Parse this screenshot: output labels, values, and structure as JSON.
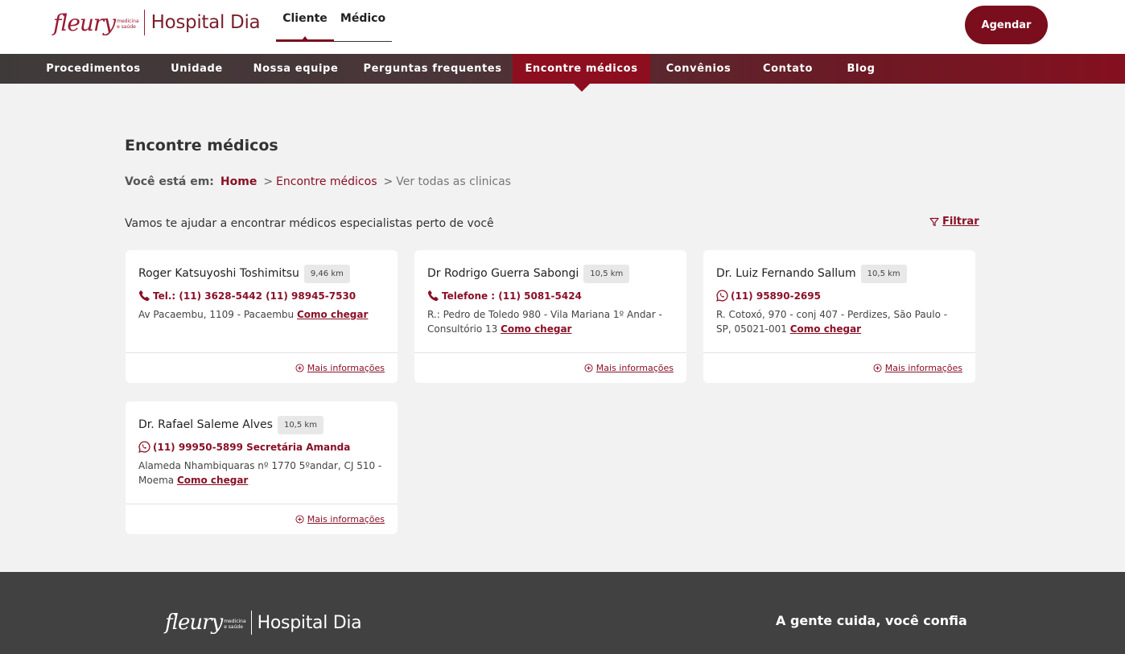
{
  "header": {
    "logo_brand": "fleury",
    "logo_tagline_1": "medicina",
    "logo_tagline_2": "e saúde",
    "logo_product": "Hospital Dia",
    "tabs": [
      {
        "label": "Cliente",
        "active": true
      },
      {
        "label": "Médico",
        "active": false
      }
    ],
    "cta_label": "Agendar"
  },
  "nav": {
    "items": [
      {
        "label": "Procedimentos"
      },
      {
        "label": "Unidade"
      },
      {
        "label": "Nossa equipe"
      },
      {
        "label": "Perguntas frequentes"
      },
      {
        "label": "Encontre médicos",
        "active": true
      },
      {
        "label": "Convênios"
      },
      {
        "label": "Contato"
      },
      {
        "label": "Blog"
      }
    ]
  },
  "main": {
    "title": "Encontre médicos",
    "breadcrumb": {
      "label": "Você está em:",
      "home": "Home",
      "sep": ">",
      "link": "Encontre médicos",
      "current": "Ver todas as clinicas"
    },
    "intro": "Vamos te ajudar a encontrar médicos especialistas perto de você",
    "filter_label": "Filtrar",
    "cards": [
      {
        "name": "Roger Katsuyoshi Toshimitsu",
        "distance": "9,46 km",
        "contact_icon": "phone-icon",
        "contact": "Tel.: (11) 3628-5442 (11) 98945-7530",
        "address": "Av Pacaembu, 1109 - Pacaembu",
        "directions": "Como chegar",
        "more": "Mais informações"
      },
      {
        "name": "Dr Rodrigo Guerra Sabongi",
        "distance": "10,5 km",
        "contact_icon": "phone-icon",
        "contact": "Telefone : (11) 5081-5424",
        "address": "R.: Pedro de Toledo 980 - Vila Mariana 1º Andar - Consultório 13",
        "directions": "Como chegar",
        "more": "Mais informações"
      },
      {
        "name": "Dr. Luiz Fernando Sallum",
        "distance": "10,5 km",
        "contact_icon": "whatsapp-icon",
        "contact": "(11) 95890-2695",
        "address": "R. Cotoxó, 970 - conj 407 - Perdizes, São Paulo - SP, 05021-001",
        "directions": "Como chegar",
        "more": "Mais informações"
      },
      {
        "name": "Dr. Rafael Saleme Alves",
        "distance": "10,5 km",
        "contact_icon": "whatsapp-icon",
        "contact": "(11) 99950-5899 Secretária Amanda",
        "address": "Alameda Nhambiquaras nº 1770 5ºandar, CJ 510 - Moema",
        "directions": "Como chegar",
        "more": "Mais informações"
      }
    ]
  },
  "footer": {
    "logo_brand": "fleury",
    "logo_tagline_1": "medicina",
    "logo_tagline_2": "e saúde",
    "logo_product": "Hospital Dia",
    "slogan": "A gente cuida, você confia"
  },
  "colors": {
    "brand": "#8a1026",
    "cta": "#7a0e1c",
    "footer_bg": "#414141",
    "page_bg": "#f2f2f2"
  }
}
